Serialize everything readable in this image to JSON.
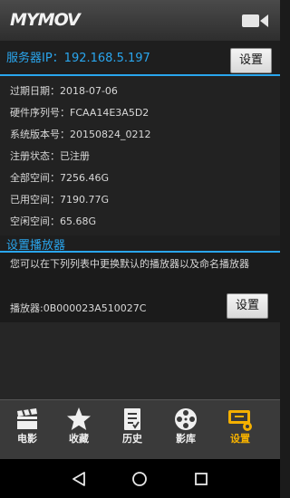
{
  "header": {
    "logo": "MYMOV",
    "camera_icon": "video-camera-icon"
  },
  "server": {
    "label": "服务器IP：192.168.5.197",
    "button": "设置"
  },
  "info": [
    "过期日期：2018-07-06",
    "硬件序列号：FCAA14E3A5D2",
    "系统版本号：20150824_0212",
    "注册状态：已注册",
    "全部空间：7256.46G",
    "已用空间：7190.77G",
    "空闲空间：65.68G"
  ],
  "player": {
    "section_title": "设置播放器",
    "description": "您可以在下列列表中更换默认的播放器以及命名播放器",
    "name": "播放器:0B000023A510027C",
    "button": "设置"
  },
  "nav": {
    "items": [
      {
        "label": "电影",
        "icon": "clapperboard-icon",
        "active": false
      },
      {
        "label": "收藏",
        "icon": "star-icon",
        "active": false
      },
      {
        "label": "历史",
        "icon": "history-document-icon",
        "active": false
      },
      {
        "label": "影库",
        "icon": "film-reel-icon",
        "active": false
      },
      {
        "label": "设置",
        "icon": "settings-device-icon",
        "active": true
      }
    ]
  },
  "colors": {
    "accent": "#2aa6ee",
    "active": "#f4b000"
  },
  "system_nav": {
    "back_icon": "back-triangle-icon",
    "home_icon": "home-circle-icon",
    "recents_icon": "recents-square-icon"
  }
}
